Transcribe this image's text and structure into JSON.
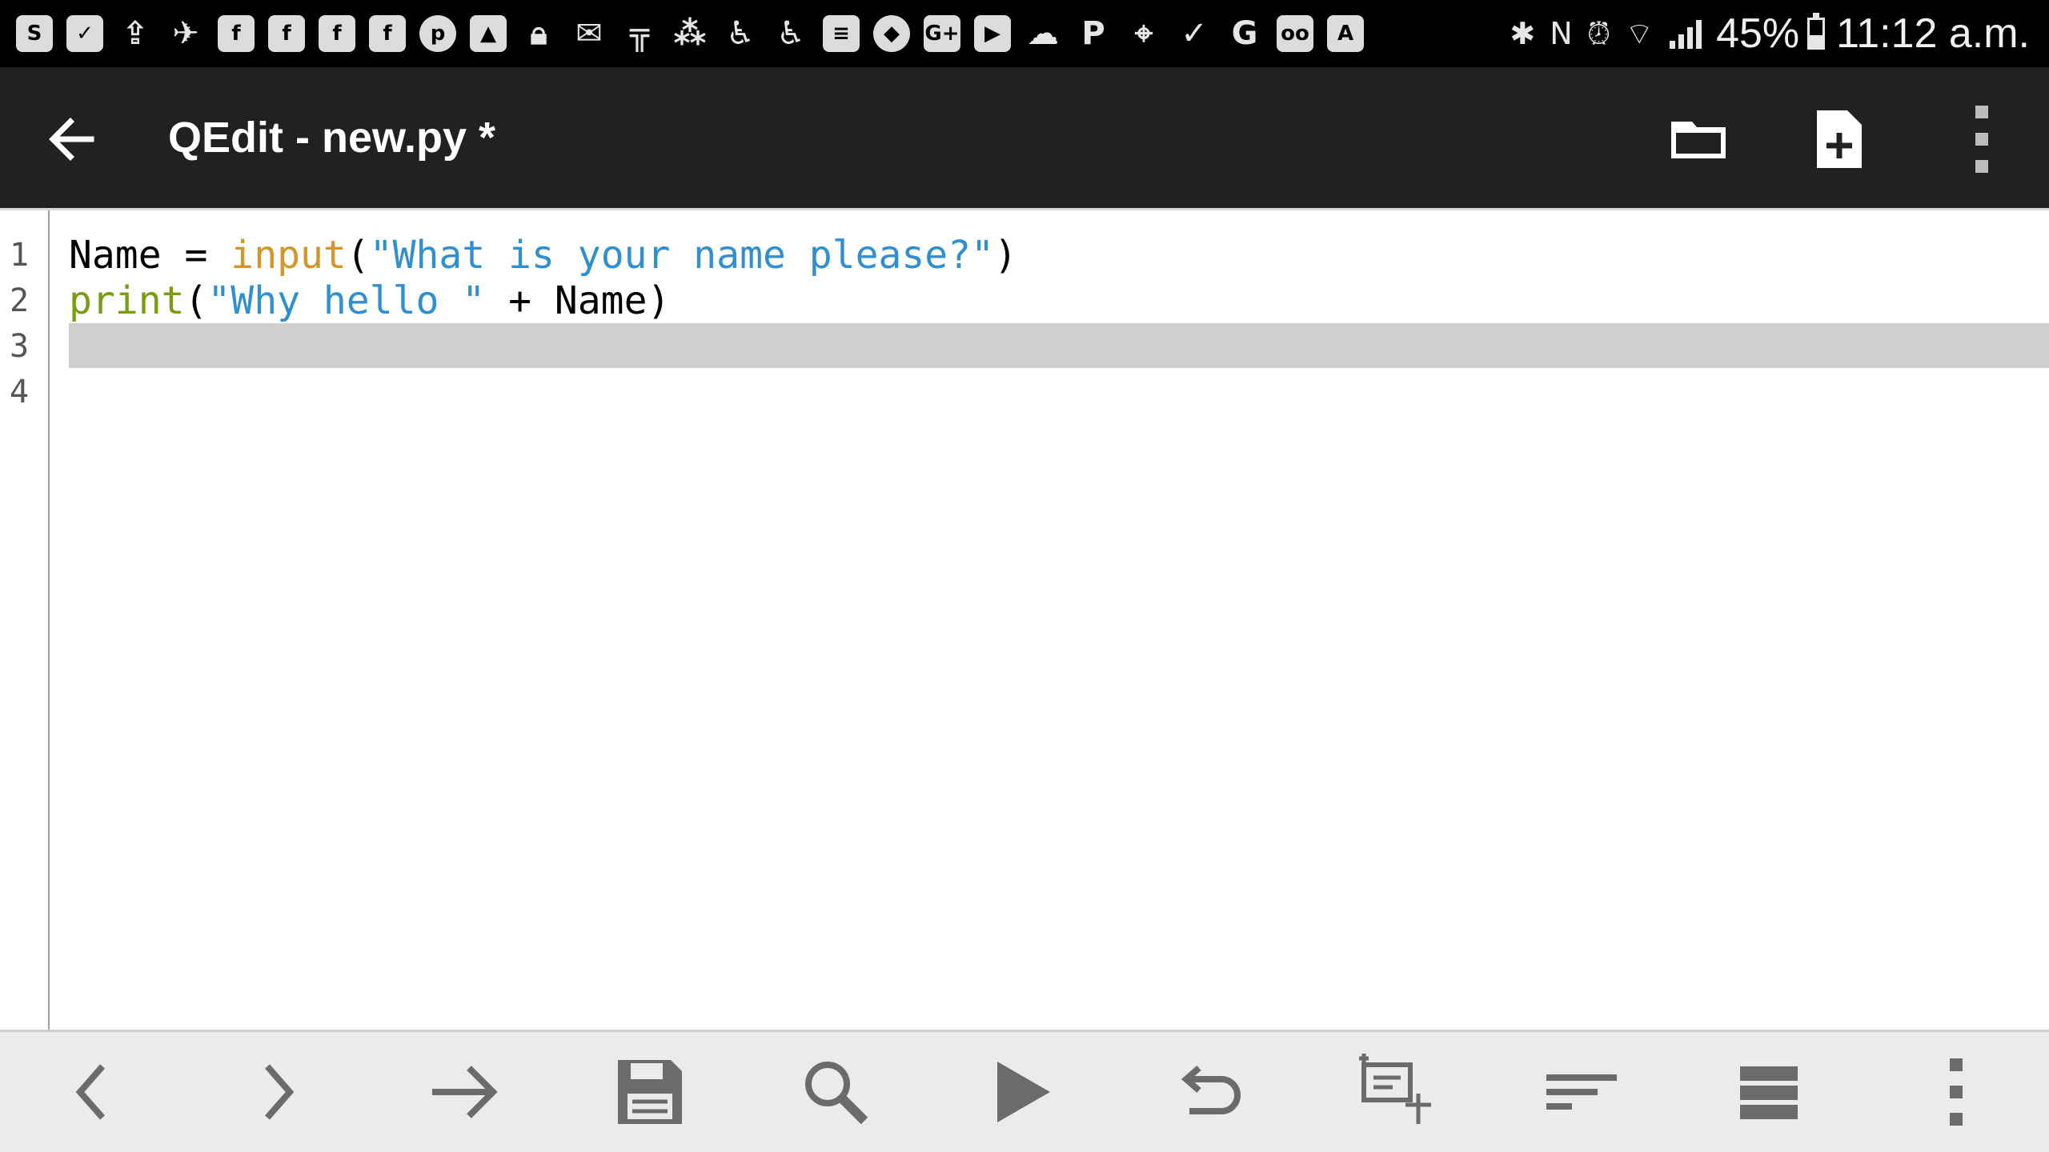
{
  "status_bar": {
    "left_icons": [
      "s-icon",
      "briefcase-check-icon",
      "briefcase-upload-icon",
      "airplane-icon",
      "facebook-icon",
      "facebook-icon",
      "facebook-icon",
      "facebook-icon",
      "pinterest-icon",
      "image-icon",
      "lock-icon",
      "mail-icon",
      "ifttt-icon",
      "dots-cluster-icon",
      "accessibility-icon",
      "accessibility-icon",
      "document-icon",
      "shield-icon",
      "google-plus-icon",
      "youtube-icon",
      "cloud-icon",
      "paypal-icon",
      "map-icon",
      "check-icon",
      "google-icon",
      "voicemail-icon",
      "font-icon"
    ],
    "right_icons": [
      "bluetooth-icon",
      "nfc-icon",
      "alarm-icon",
      "wifi-icon",
      "signal-icon",
      "battery-icon"
    ],
    "battery_percent": "45%",
    "battery_level": 0.45,
    "time": "11:12 a.m."
  },
  "app_bar": {
    "title": "QEdit - new.py *",
    "actions": [
      "back-icon",
      "folder-icon",
      "new-file-icon",
      "overflow-menu-icon"
    ]
  },
  "editor": {
    "language": "python",
    "lines": [
      {
        "number": "1",
        "text": "Name = input(\"What is your name please?\")"
      },
      {
        "number": "2",
        "text": "print(\"Why hello \" + Name)"
      },
      {
        "number": "3",
        "text": ""
      },
      {
        "number": "4",
        "text": ""
      }
    ],
    "active_line": 3,
    "syntax_colors": {
      "builtin": "#d4952b",
      "keyword": "#7a9c12",
      "string": "#2f8fd0",
      "text": "#000000",
      "active_line_bg": "#cfcfcf"
    },
    "tokens": {
      "l1_name": "Name",
      "l1_op": " = ",
      "l1_fn": "input",
      "l1_open": "(",
      "l1_str": "\"What is your name please?\"",
      "l1_close": ")",
      "l2_fn": "print",
      "l2_open": "(",
      "l2_str": "\"Why hello \"",
      "l2_rest": " + Name)"
    }
  },
  "toolbar": {
    "buttons": [
      "chevron-left-icon",
      "chevron-right-icon",
      "goto-arrow-icon",
      "save-icon",
      "search-icon",
      "run-icon",
      "undo-icon",
      "add-snippet-icon",
      "format-text-icon",
      "list-lines-icon",
      "more-vertical-icon"
    ]
  },
  "colors": {
    "status_bar_bg": "#000000",
    "app_bar_bg": "#212121",
    "editor_bg": "#ffffff",
    "toolbar_bg": "#ebebeb",
    "toolbar_icon": "#6b6b6b"
  }
}
